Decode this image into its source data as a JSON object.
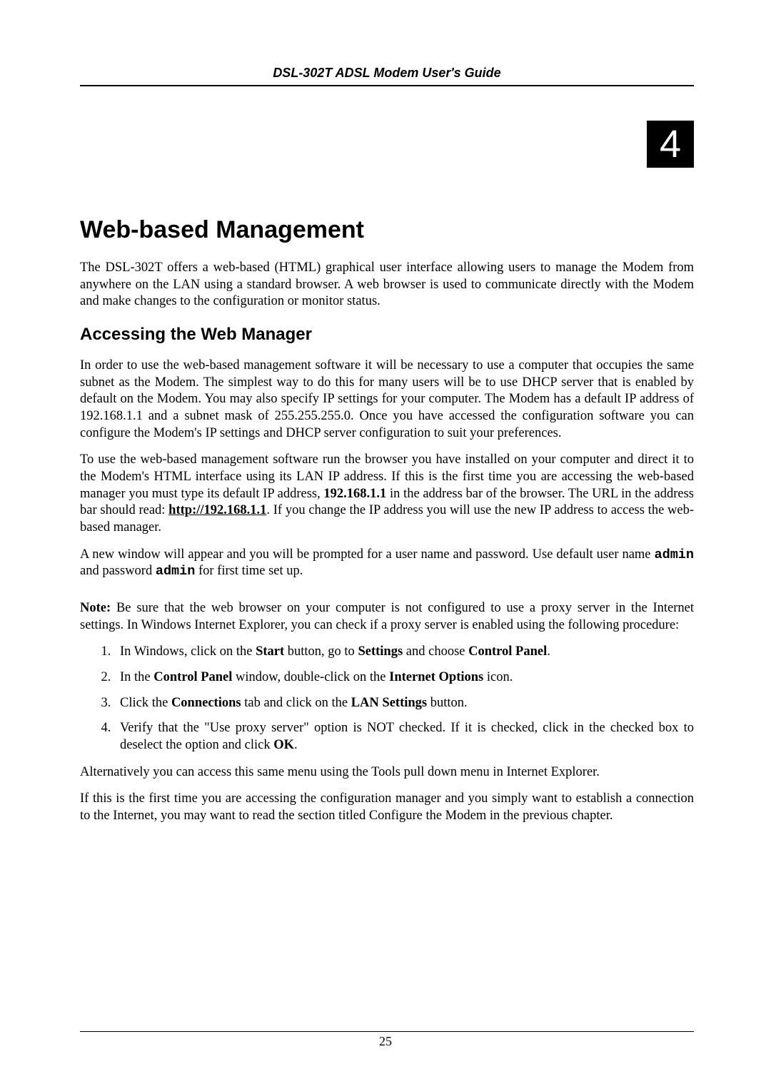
{
  "header": {
    "title": "DSL-302T ADSL Modem User's Guide"
  },
  "chapter": {
    "number": "4"
  },
  "main": {
    "title": "Web-based Management",
    "intro": "The DSL-302T offers a web-based (HTML) graphical user interface allowing users to manage the Modem from anywhere on the LAN using a standard browser. A web browser is used to communicate directly with the Modem and make changes to the configuration or monitor status."
  },
  "section1": {
    "title": "Accessing the Web Manager",
    "p1": "In order to use the web-based management software it will be necessary to use a computer that occupies the same subnet as the Modem. The simplest way to do this for many users will be to use DHCP server that is enabled by default on the Modem. You may also specify IP settings for your computer. The Modem has a default IP address of 192.168.1.1 and a subnet mask of 255.255.255.0. Once you have accessed the configuration software you can configure the Modem's IP settings and DHCP server configuration to suit your preferences.",
    "p2_part1": "To use the web-based management software run the browser you have installed on your computer and direct it to the Modem's HTML interface using its LAN IP address. If this is the first time you are accessing the web-based manager you must type its default IP address, ",
    "p2_ip": "192.168.1.1",
    "p2_part2": " in the address bar of the browser. The URL in the address bar should read: ",
    "p2_url": "http://192.168.1.1",
    "p2_part3": ". If you change the IP address you will use the new IP address to access the web-based manager.",
    "p3_part1": "A new window will appear and you will be prompted for a user name and password. Use default user name ",
    "p3_user": "admin",
    "p3_part2": " and password ",
    "p3_pass": "admin",
    "p3_part3": " for first time set up.",
    "note_label": "Note:",
    "note_text": " Be sure that the web browser on your computer is not configured to use a proxy server in the Internet settings. In Windows Internet Explorer, you can check if a proxy server is enabled using the following procedure:",
    "step1_a": "In Windows, click on the ",
    "step1_b": "Start",
    "step1_c": " button, go to ",
    "step1_d": "Settings",
    "step1_e": " and choose ",
    "step1_f": "Control Panel",
    "step1_g": ".",
    "step2_a": "In the ",
    "step2_b": "Control Panel",
    "step2_c": " window, double-click on the ",
    "step2_d": "Internet Options",
    "step2_e": " icon.",
    "step3_a": "Click the ",
    "step3_b": "Connections",
    "step3_c": " tab and click on the ",
    "step3_d": "LAN Settings",
    "step3_e": " button.",
    "step4_a": "Verify that the \"Use proxy server\" option is NOT checked. If it is checked, click in the checked box to deselect the option and click ",
    "step4_b": "OK",
    "step4_c": ".",
    "p4": "Alternatively you can access this same menu using the Tools pull down menu in Internet Explorer.",
    "p5": "If this is the first time you are accessing the configuration manager and you simply want to establish a connection to the Internet, you may want to read the section titled Configure the Modem in the previous chapter."
  },
  "footer": {
    "page_number": "25"
  }
}
